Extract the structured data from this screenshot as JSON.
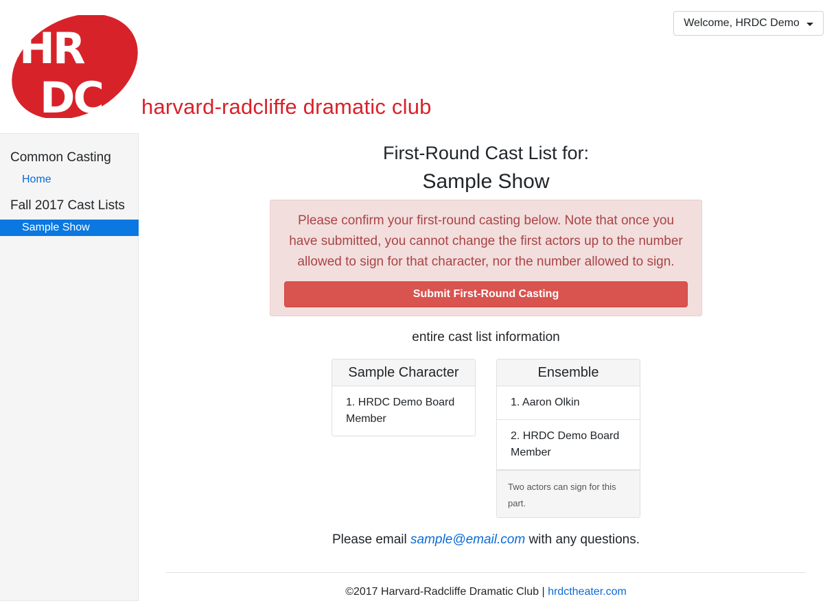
{
  "brand": {
    "logo_text_top": "HR",
    "logo_text_bottom": "DC",
    "club_name": "harvard-radcliffe dramatic club",
    "brand_color": "#d8222a"
  },
  "user_menu": {
    "label": "Welcome, HRDC Demo"
  },
  "sidebar": {
    "heading1": "Common Casting",
    "home_link": "Home",
    "heading2": "Fall 2017 Cast Lists",
    "active_item": "Sample Show"
  },
  "main": {
    "title_line1": "First-Round Cast List for:",
    "title_line2": "Sample Show",
    "alert_text": "Please confirm your first-round casting below. Note that once you have submitted, you cannot change the first actors up to the number allowed to sign for that character, nor the number allowed to sign.",
    "submit_label": "Submit First-Round Casting",
    "info_label": "entire cast list information",
    "characters": [
      {
        "name": "Sample Character",
        "actors": [
          "1. HRDC Demo Board Member"
        ]
      },
      {
        "name": "Ensemble",
        "actors": [
          "1. Aaron Olkin",
          "2. HRDC Demo Board Member"
        ],
        "note": "Two actors can sign for this part."
      }
    ],
    "email_prefix": "Please email",
    "email": "sample@email.com",
    "email_suffix": "with any questions."
  },
  "footer": {
    "copyright": "©2017 Harvard-Radcliffe Dramatic Club |",
    "site_link": "hrdctheater.com"
  },
  "colors": {
    "link": "#0b6ad3",
    "active": "#0a78e0",
    "danger": "#d9534f",
    "alert_bg": "#f3dede"
  }
}
